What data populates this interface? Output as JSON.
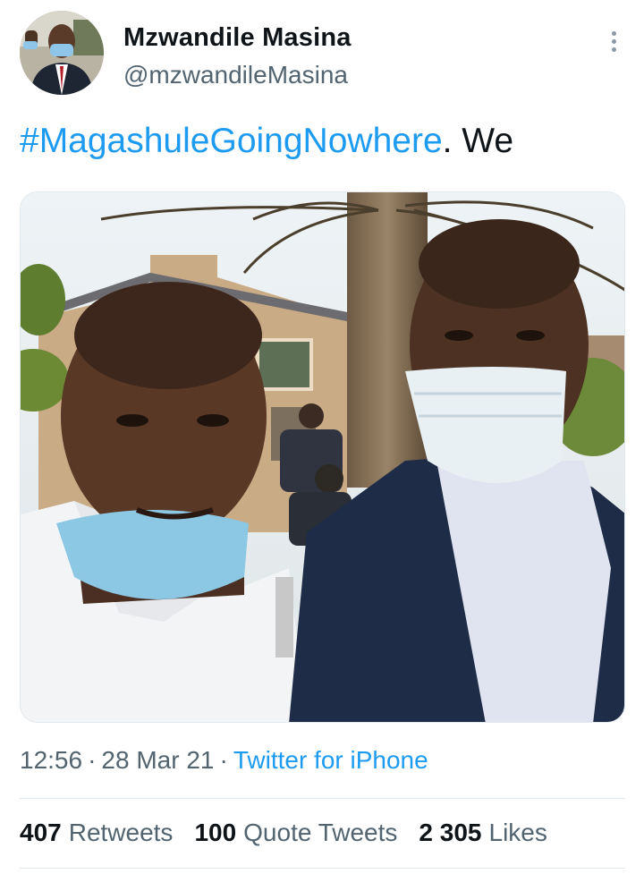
{
  "user": {
    "display_name": "Mzwandile Masina",
    "handle": "@mzwandileMasina"
  },
  "tweet": {
    "hashtag": "#MagashuleGoingNowhere",
    "text_after": ". We"
  },
  "meta": {
    "time": "12:56",
    "separator": "·",
    "date": "28 Mar 21",
    "source": "Twitter for iPhone"
  },
  "stats": {
    "retweets_count": "407",
    "retweets_label": "Retweets",
    "quotes_count": "100",
    "quotes_label": "Quote Tweets",
    "likes_count": "2 305",
    "likes_label": "Likes"
  },
  "icons": {
    "more": "more-vertical-icon"
  },
  "colors": {
    "link": "#1d9bf0",
    "secondary_text": "#536471",
    "primary_text": "#0f1419",
    "divider": "#e1e8ed"
  }
}
